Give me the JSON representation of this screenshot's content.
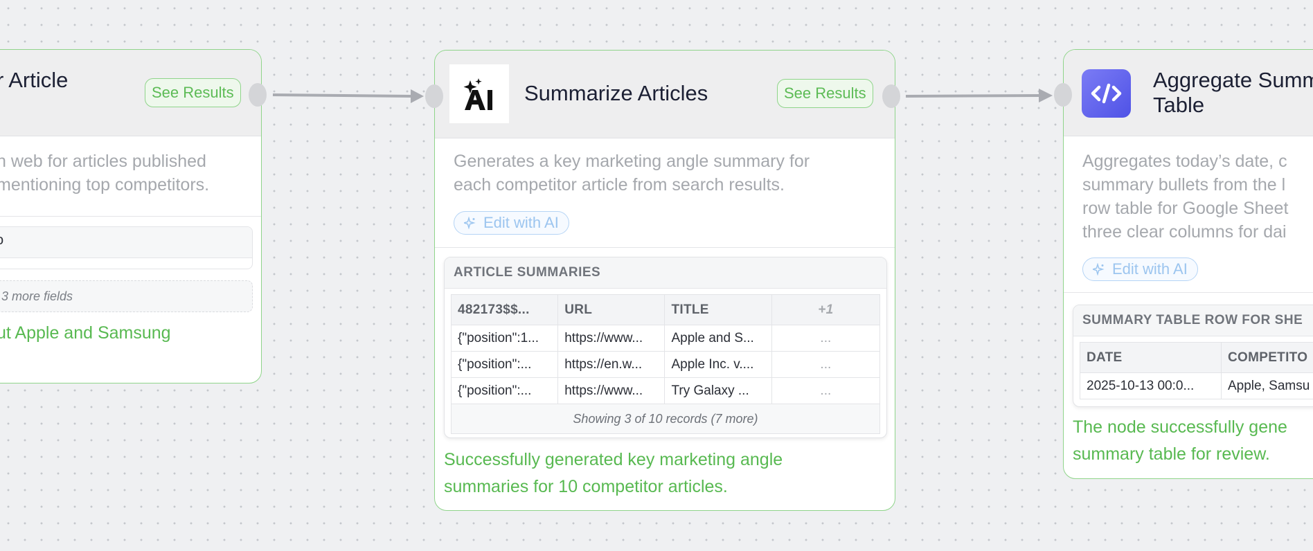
{
  "canvas": {
    "node_left": {
      "title": "r Article",
      "see_results": "See Results",
      "description": "n web for articles published\nmentioning top competitors.",
      "field_value": "o",
      "more_fields": "3 more fields",
      "success": "ut Apple and Samsung"
    },
    "node_center": {
      "icon": "ai-sparkle-icon",
      "title": "Summarize Articles",
      "see_results": "See Results",
      "description": "Generates a key marketing angle summary for\neach competitor article from search results.",
      "edit_ai": "Edit with AI",
      "card_title": "ARTICLE SUMMARIES",
      "columns": [
        "482173$$...",
        "URL",
        "TITLE",
        "+1"
      ],
      "rows": [
        [
          "{\"position\":1...",
          "https://www...",
          "Apple and S...",
          "..."
        ],
        [
          "{\"position\":...",
          "https://en.w...",
          "Apple Inc. v....",
          "..."
        ],
        [
          "{\"position\":...",
          "https://www...",
          "Try Galaxy ...",
          "..."
        ]
      ],
      "footer": "Showing 3 of 10 records (7 more)",
      "success": "Successfully generated key marketing angle\nsummaries for 10 competitor articles."
    },
    "node_right": {
      "icon": "code-icon",
      "title_line1": "Aggregate Summ",
      "title_line2": "Table",
      "description": "Aggregates today’s date, c\nsummary bullets from the l\nrow table for Google Sheet\nthree clear columns for dai",
      "edit_ai": "Edit with AI",
      "card_title": "SUMMARY TABLE ROW FOR SHE",
      "columns": [
        "DATE",
        "COMPETITO"
      ],
      "rows": [
        [
          "2025-10-13 00:0...",
          "Apple, Samsu"
        ]
      ],
      "success": "The node successfully gene\nsummary table for review."
    }
  },
  "colors": {
    "accent_green": "#58b951",
    "node_border": "#8fd48a",
    "edit_blue": "#9cc5ef",
    "code_icon_gradient": [
      "#7b7cf5",
      "#4f52e6"
    ]
  }
}
